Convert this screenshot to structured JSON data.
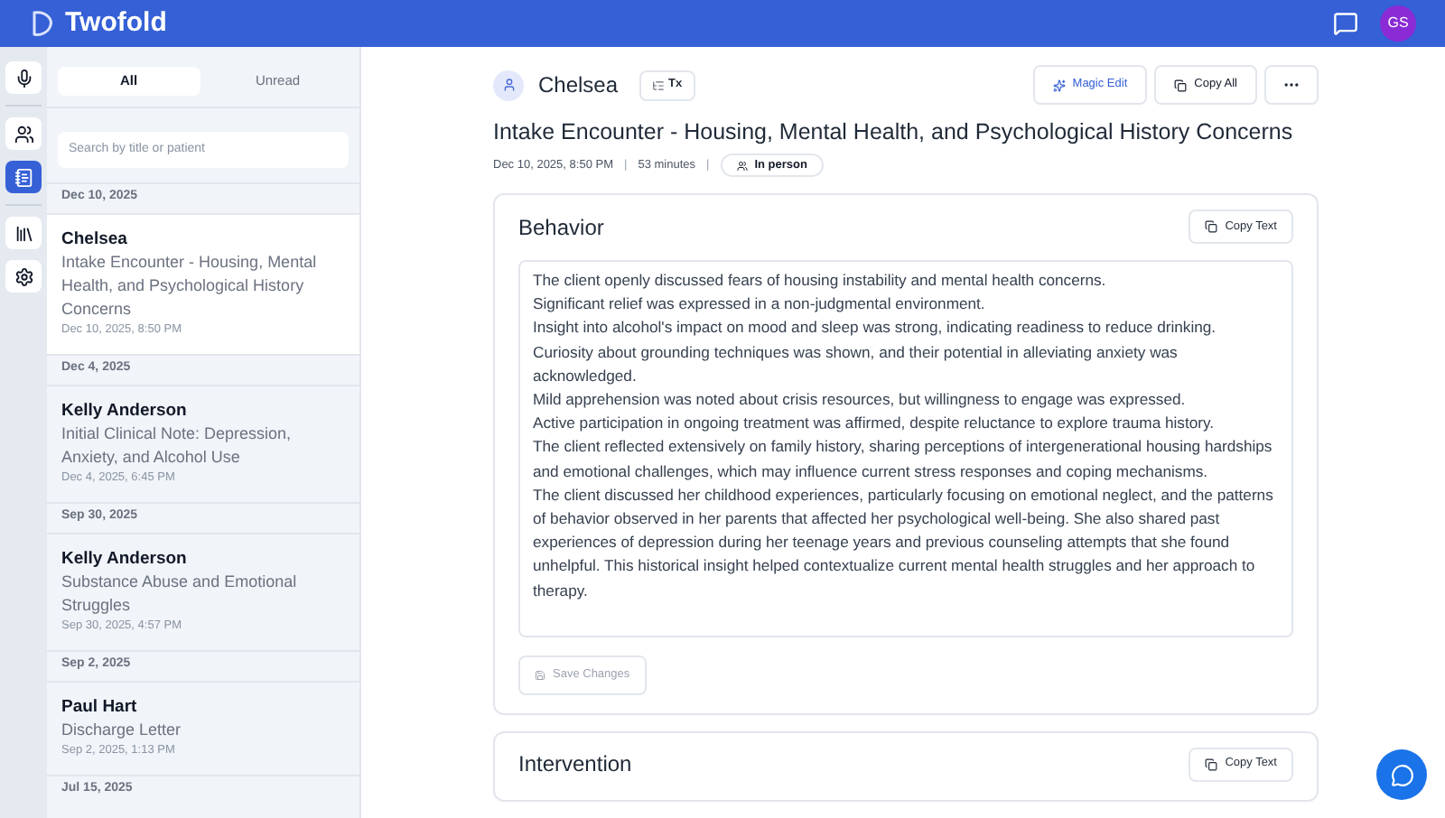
{
  "app": {
    "name": "Twofold",
    "avatar_initials": "GS"
  },
  "rail": [
    {
      "kind": "mic",
      "selected": false
    },
    {
      "kind": "users",
      "selected": false
    },
    {
      "kind": "notebook",
      "selected": true
    },
    {
      "kind": "library",
      "selected": false
    },
    {
      "kind": "settings",
      "selected": false
    }
  ],
  "filter_tabs": [
    {
      "label": "All",
      "selected": true
    },
    {
      "label": "Unread",
      "selected": false
    }
  ],
  "search": {
    "placeholder": "Search by title or patient"
  },
  "note_groups": [
    {
      "date": "Dec 10, 2025",
      "notes": [
        {
          "patient": "Chelsea",
          "title": "Intake Encounter - Housing, Mental Health, and Psychological History Concerns",
          "time": "Dec 10, 2025, 8:50 PM",
          "selected": true
        }
      ]
    },
    {
      "date": "Dec 4, 2025",
      "notes": [
        {
          "patient": "Kelly Anderson",
          "title": "Initial Clinical Note: Depression, Anxiety, and Alcohol Use",
          "time": "Dec 4, 2025, 6:45 PM",
          "selected": false
        }
      ]
    },
    {
      "date": "Sep 30, 2025",
      "notes": [
        {
          "patient": "Kelly Anderson",
          "title": "Substance Abuse and Emotional Struggles",
          "time": "Sep 30, 2025, 4:57 PM",
          "selected": false
        }
      ]
    },
    {
      "date": "Sep 2, 2025",
      "notes": [
        {
          "patient": "Paul Hart",
          "title": "Discharge Letter",
          "time": "Sep 2, 2025, 1:13 PM",
          "selected": false
        }
      ]
    },
    {
      "date": "Jul 15, 2025"
    }
  ],
  "note": {
    "patient": "Chelsea",
    "tx_label": "Tx",
    "actions": [
      "Magic Edit",
      "Copy All"
    ],
    "title": "Intake Encounter - Housing, Mental Health, and Psychological History Concerns",
    "date": "Dec 10, 2025, 8:50 PM",
    "separators": [
      "|",
      "|"
    ],
    "duration": "53 minutes",
    "mode": "In person",
    "sections": [
      {
        "heading": "Behavior",
        "copy_label": "Copy Text",
        "save_label": "Save Changes",
        "body": "The client openly discussed fears of housing instability and mental health concerns.\nSignificant relief was expressed in a non-judgmental environment.\nInsight into alcohol's impact on mood and sleep was strong, indicating readiness to reduce drinking.\nCuriosity about grounding techniques was shown, and their potential in alleviating anxiety was acknowledged.\nMild apprehension was noted about crisis resources, but willingness to engage was expressed.\nActive participation in ongoing treatment was affirmed, despite reluctance to explore trauma history.\nThe client reflected extensively on family history, sharing perceptions of intergenerational housing hardships and emotional challenges, which may influence current stress responses and coping mechanisms.\nThe client discussed her childhood experiences, particularly focusing on emotional neglect, and the patterns of behavior observed in her parents that affected her psychological well-being. She also shared past experiences of depression during her teenage years and previous counseling attempts that she found unhelpful. This historical insight helped contextualize current mental health struggles and her approach to therapy."
      },
      {
        "heading": "Intervention",
        "copy_label": "Copy Text"
      }
    ]
  }
}
